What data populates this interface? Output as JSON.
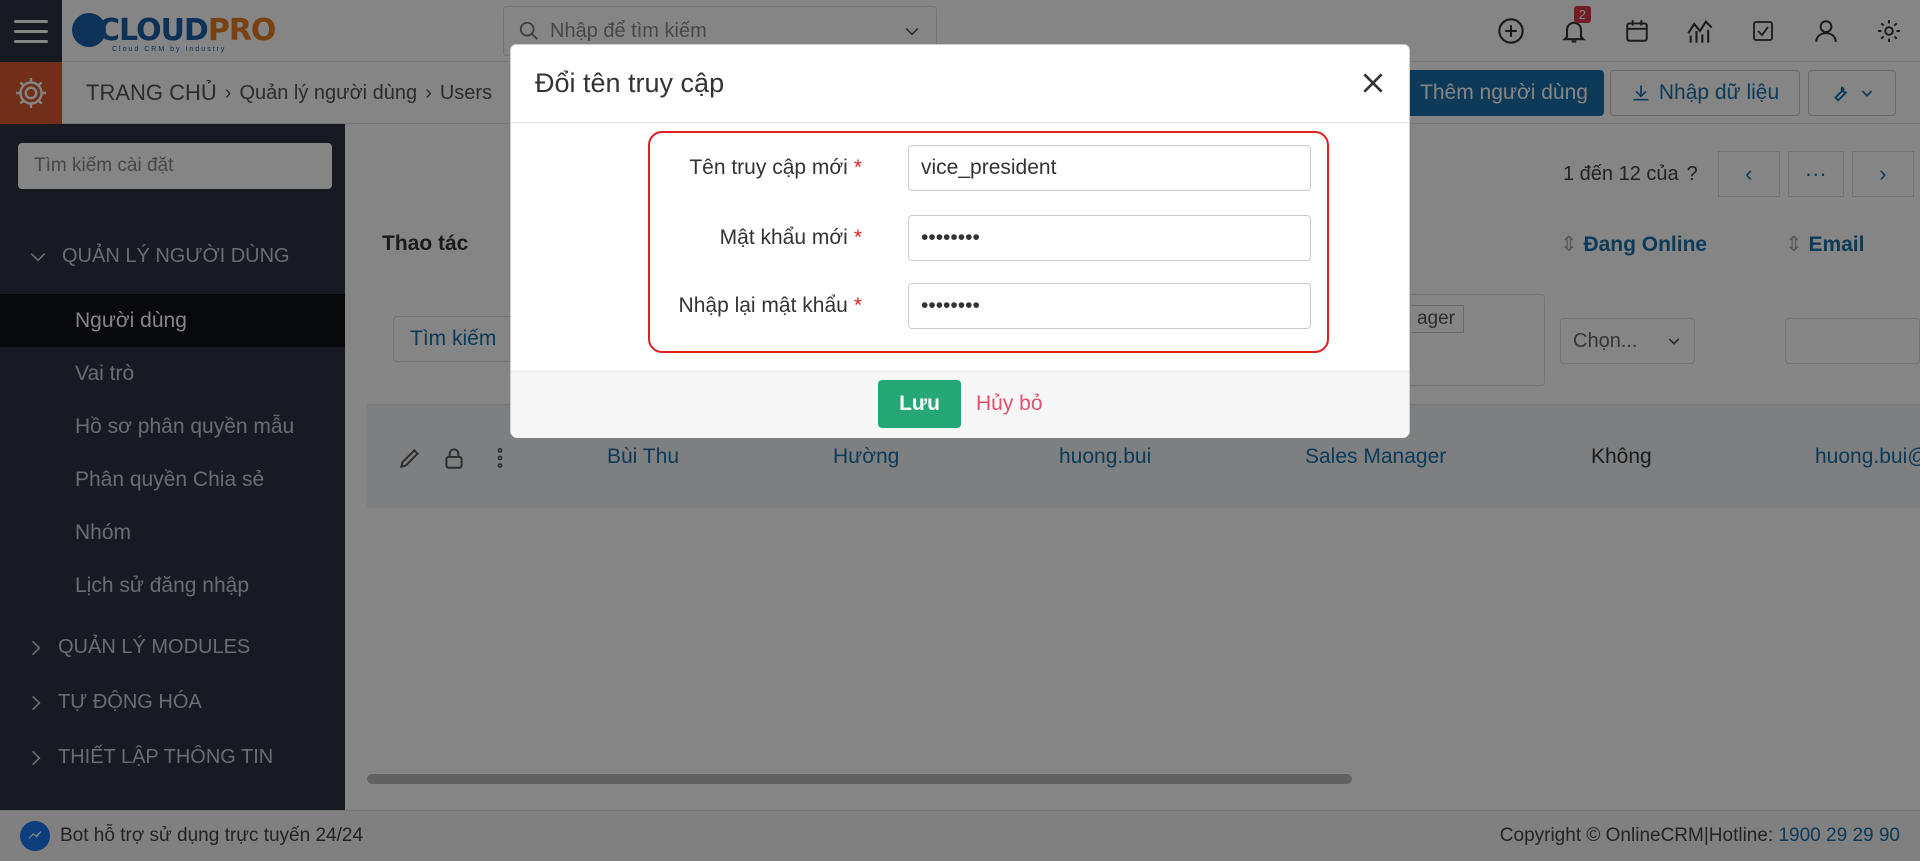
{
  "topbar": {
    "logo_main": "CLOUD",
    "logo_accent": "PRO",
    "logo_sub": "Cloud CRM by Industry",
    "search_placeholder": "Nhập để tìm kiếm",
    "notification_count": "2"
  },
  "breadcrumb": {
    "home": "TRANG CHỦ",
    "level1": "Quản lý người dùng",
    "level2": "Users"
  },
  "actions": {
    "add_user": "Thêm người dùng",
    "import": "Nhập dữ liệu"
  },
  "sidebar": {
    "search_placeholder": "Tìm kiếm cài đặt",
    "groups": [
      {
        "label": "QUẢN LÝ NGƯỜI DÙNG",
        "expanded": true
      },
      {
        "label": "QUẢN LÝ MODULES",
        "expanded": false
      },
      {
        "label": "TỰ ĐỘNG HÓA",
        "expanded": false
      },
      {
        "label": "THIẾT LẬP THÔNG TIN",
        "expanded": false
      }
    ],
    "items": [
      {
        "label": "Người dùng",
        "active": true
      },
      {
        "label": "Vai trò"
      },
      {
        "label": "Hồ sơ phân quyền mẫu"
      },
      {
        "label": "Phân quyền Chia sẻ"
      },
      {
        "label": "Nhóm"
      },
      {
        "label": "Lịch sử đăng nhập"
      }
    ]
  },
  "table": {
    "pager_text": "1 đến 12 của",
    "pager_unknown": "?",
    "pager_more": "···",
    "columns": {
      "actions": "Thao tác",
      "online": "Đang Online",
      "email": "Email"
    },
    "filters": {
      "search_button": "Tìm kiếm",
      "role_tag": "ager",
      "online_select": "Chọn..."
    },
    "rows": [
      {
        "first_name": "Bùi Thu",
        "last_name": "Hường",
        "username": "huong.bui",
        "role": "Sales Manager",
        "online": "Không",
        "email": "huong.bui@"
      }
    ]
  },
  "modal": {
    "title": "Đổi tên truy cập",
    "fields": [
      {
        "label": "Tên truy cập mới",
        "value": "vice_president",
        "type": "text"
      },
      {
        "label": "Mật khẩu mới",
        "value": "••••••••",
        "type": "password"
      },
      {
        "label": "Nhập lại mật khẩu",
        "value": "••••••••",
        "type": "password"
      }
    ],
    "required_mark": "*",
    "save_label": "Lưu",
    "cancel_label": "Hủy bỏ"
  },
  "footer": {
    "bot_text": "Bot hỗ trợ sử dụng trực tuyến 24/24",
    "copyright": "Copyright © OnlineCRM|Hotline:",
    "hotline": "1900 29 29 90"
  },
  "colors": {
    "brand_blue": "#1a6fa8",
    "sidebar_bg": "#2c3440",
    "settings_orange": "#d75a2b",
    "save_green": "#26a776",
    "cancel_pink": "#e0506f",
    "highlight_red": "#e02020"
  }
}
